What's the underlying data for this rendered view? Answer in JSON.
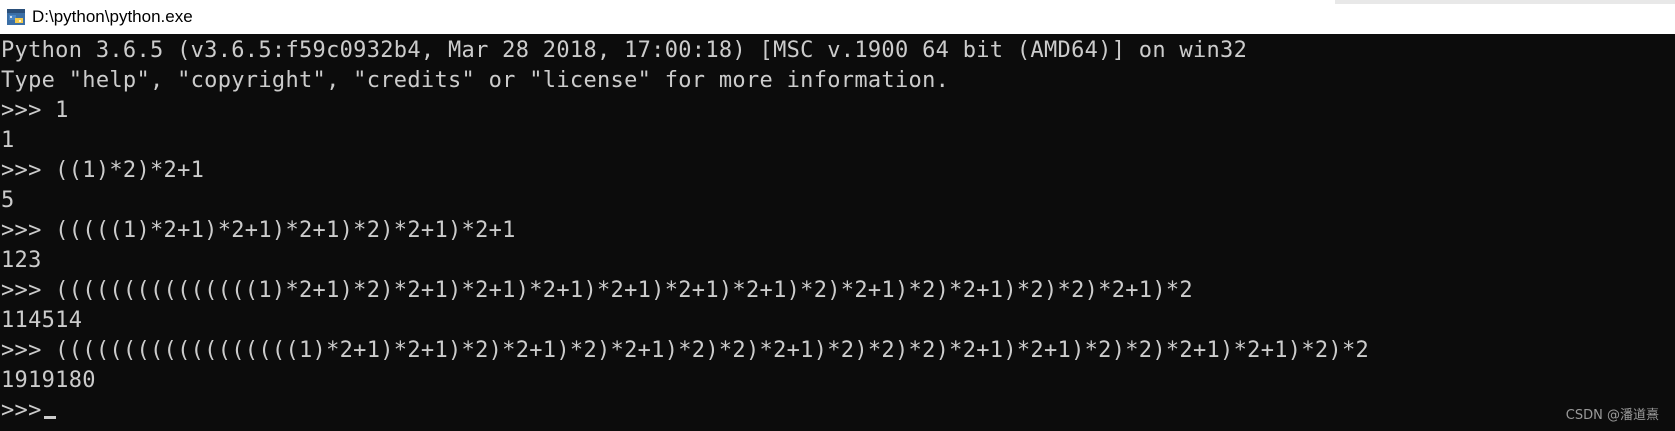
{
  "window": {
    "title": "D:\\python\\python.exe",
    "icon": "python-icon"
  },
  "console": {
    "lines": [
      "Python 3.6.5 (v3.6.5:f59c0932b4, Mar 28 2018, 17:00:18) [MSC v.1900 64 bit (AMD64)] on win32",
      "Type \"help\", \"copyright\", \"credits\" or \"license\" for more information.",
      ">>> 1",
      "1",
      ">>> ((1)*2)*2+1",
      "5",
      ">>> (((((1)*2+1)*2+1)*2+1)*2)*2+1)*2+1",
      "123",
      ">>> (((((((((((((((1)*2+1)*2)*2+1)*2+1)*2+1)*2+1)*2+1)*2+1)*2)*2+1)*2)*2+1)*2)*2)*2+1)*2",
      "114514",
      ">>> ((((((((((((((((((1)*2+1)*2+1)*2)*2+1)*2)*2+1)*2)*2)*2+1)*2)*2)*2)*2+1)*2+1)*2)*2)*2+1)*2+1)*2)*2",
      "1919180",
      ">>>"
    ]
  },
  "watermark": "CSDN @潘道熹"
}
